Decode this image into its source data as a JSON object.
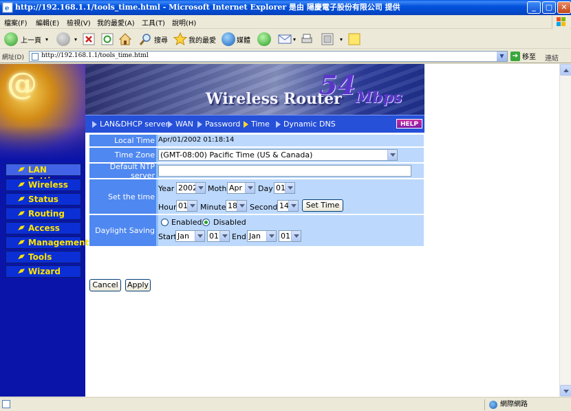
{
  "window": {
    "title": "http://192.168.1.1/tools_time.html - Microsoft Internet Explorer 是由 陽慶電子股份有限公司 提供",
    "min": "_",
    "max": "▢",
    "close": "✕"
  },
  "menu": [
    "檔案(F)",
    "編輯(E)",
    "檢視(V)",
    "我的最愛(A)",
    "工具(T)",
    "說明(H)"
  ],
  "toolbar": {
    "back": "上一頁",
    "search": "搜尋",
    "favorites": "我的最愛",
    "media": "媒體"
  },
  "address": {
    "label": "網址(D)",
    "url": "http://192.168.1.1/tools_time.html",
    "go": "移至",
    "links": "連結"
  },
  "banner": {
    "brand": "Wireless Router",
    "speed": "54",
    "unit": "Mbps",
    "help": "HELP"
  },
  "topnav": [
    "LAN&DHCP server",
    "WAN",
    "Password",
    "Time",
    "Dynamic DNS"
  ],
  "sidebar": [
    "LAN Setting",
    "Wireless",
    "Status",
    "Routing",
    "Access",
    "Management",
    "Tools",
    "Wizard"
  ],
  "form": {
    "local_time_label": "Local Time",
    "local_time_value": "Apr/01/2002 01:18:14",
    "time_zone_label": "Time Zone",
    "time_zone_value": "(GMT-08:00) Pacific Time (US & Canada)",
    "ntp_label": "Default NTP server",
    "ntp_value": "",
    "set_time_label": "Set the time",
    "year_label": "Year",
    "year_value": "2002",
    "month_label": "Moth",
    "month_value": "Apr",
    "day_label": "Day",
    "day_value": "01",
    "hour_label": "Hour",
    "hour_value": "01",
    "minute_label": "Minute",
    "minute_value": "18",
    "second_label": "Second",
    "second_value": "14",
    "set_time_button": "Set Time",
    "daylight_label": "Daylight Saving",
    "enabled_label": "Enabled",
    "disabled_label": "Disabled",
    "start_label": "Start",
    "start_month": "Jan",
    "start_day": "01",
    "end_label": "End",
    "end_month": "Jan",
    "end_day": "01"
  },
  "buttons": {
    "cancel": "Cancel",
    "apply": "Apply"
  },
  "status": {
    "zone": "網際網路"
  }
}
